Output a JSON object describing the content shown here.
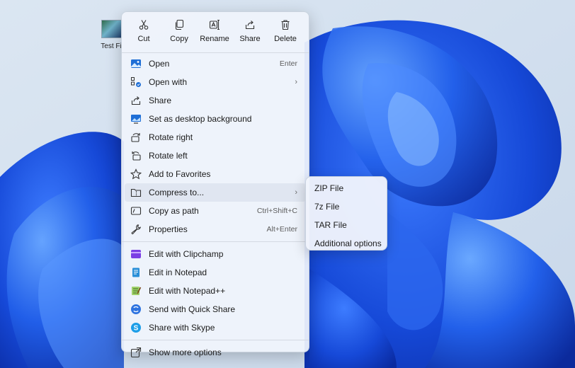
{
  "desktop": {
    "icon_label": "Test Fi"
  },
  "quick_actions": [
    {
      "label": "Cut",
      "icon": "scissors-icon"
    },
    {
      "label": "Copy",
      "icon": "copy-icon"
    },
    {
      "label": "Rename",
      "icon": "rename-icon"
    },
    {
      "label": "Share",
      "icon": "share-icon"
    },
    {
      "label": "Delete",
      "icon": "trash-icon"
    }
  ],
  "menu_items": [
    {
      "label": "Open",
      "shortcut": "Enter",
      "icon": "image-icon"
    },
    {
      "label": "Open with",
      "submenu": true,
      "icon": "open-with-icon"
    },
    {
      "label": "Share",
      "icon": "share-icon"
    },
    {
      "label": "Set as desktop background",
      "icon": "desktop-background-icon"
    },
    {
      "label": "Rotate right",
      "icon": "rotate-right-icon"
    },
    {
      "label": "Rotate left",
      "icon": "rotate-left-icon"
    },
    {
      "label": "Add to Favorites",
      "icon": "star-icon"
    },
    {
      "label": "Compress to...",
      "submenu": true,
      "icon": "zip-folder-icon"
    },
    {
      "label": "Copy as path",
      "shortcut": "Ctrl+Shift+C",
      "icon": "path-icon"
    },
    {
      "label": "Properties",
      "shortcut": "Alt+Enter",
      "icon": "wrench-icon"
    }
  ],
  "app_items": [
    {
      "label": "Edit with Clipchamp",
      "icon": "clipchamp-icon"
    },
    {
      "label": "Edit in Notepad",
      "icon": "notepad-icon"
    },
    {
      "label": "Edit with Notepad++",
      "icon": "notepadpp-icon"
    },
    {
      "label": "Send with Quick Share",
      "icon": "quick-share-icon"
    },
    {
      "label": "Share with Skype",
      "icon": "skype-icon"
    }
  ],
  "more_options": {
    "label": "Show more options",
    "icon": "more-options-icon"
  },
  "compress_submenu": [
    {
      "label": "ZIP File"
    },
    {
      "label": "7z File"
    },
    {
      "label": "TAR File"
    },
    {
      "label": "Additional options"
    }
  ],
  "colors": {
    "accent": "#1a4fd6",
    "wallpaper_bg": "#d6e3f1"
  }
}
